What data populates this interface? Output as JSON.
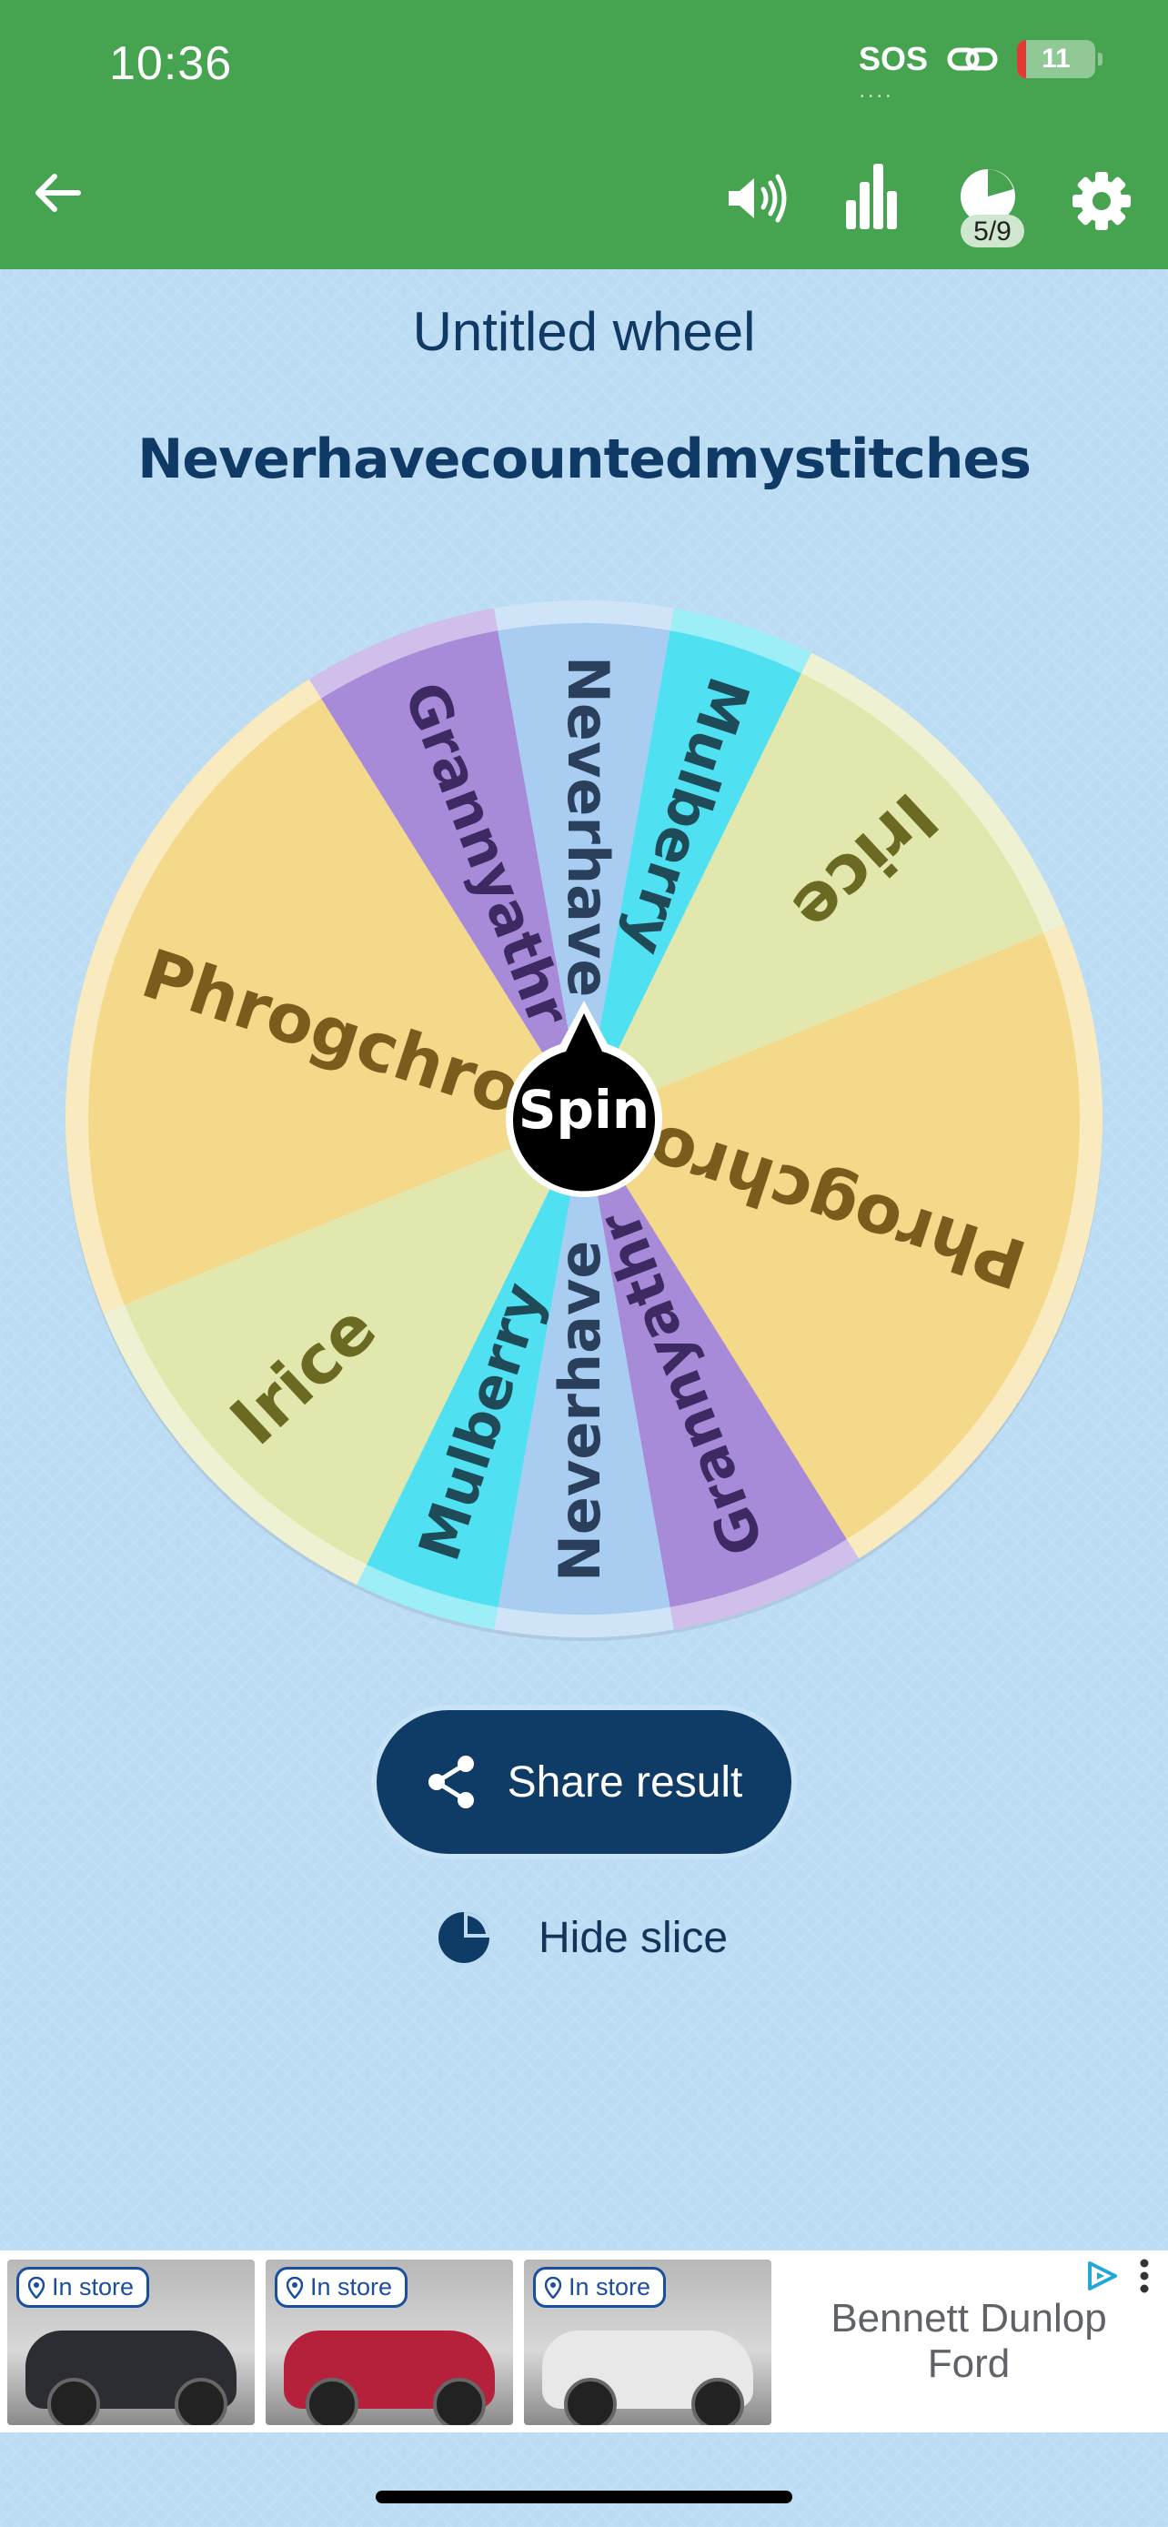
{
  "status_bar": {
    "time": "10:36",
    "sos": "SOS",
    "battery": "11"
  },
  "toolbar": {
    "progress_badge": "5/9"
  },
  "wheel": {
    "title": "Untitled wheel",
    "result": "Neverhavecountedmystitches",
    "spin_label": "Spin",
    "slices": [
      {
        "label": "Irice",
        "color": "#e2e8ad",
        "text_color": "#6b6a22"
      },
      {
        "label": "Phrogchroc",
        "color": "#f5d98a",
        "text_color": "#7a5c1c"
      },
      {
        "label": "Grannyathr",
        "color": "#a78ad8",
        "text_color": "#3e2a62"
      },
      {
        "label": "Neverhave",
        "color": "#a8cdf0",
        "text_color": "#2a3f5c"
      },
      {
        "label": "Mulberry",
        "color": "#4fe0f2",
        "text_color": "#1f4a58"
      },
      {
        "label": "Irice",
        "color": "#e2e8ad",
        "text_color": "#6b6a22"
      },
      {
        "label": "Phrogchroc",
        "color": "#f5d98a",
        "text_color": "#7a5c1c"
      },
      {
        "label": "Grannyathr",
        "color": "#a78ad8",
        "text_color": "#3e2a62"
      },
      {
        "label": "Neverhave",
        "color": "#a8cdf0",
        "text_color": "#2a3f5c"
      },
      {
        "label": "Mulberry",
        "color": "#4fe0f2",
        "text_color": "#1f4a58"
      }
    ]
  },
  "actions": {
    "share_label": "Share result",
    "hide_slice_label": "Hide slice"
  },
  "ad": {
    "badges": [
      "In store",
      "In store",
      "In store"
    ],
    "car_colors": [
      "#2b2d33",
      "#b5203a",
      "#e8e8e8"
    ],
    "advertiser": "Bennett Dunlop Ford"
  },
  "colors": {
    "app_bar": "#46a350",
    "primary": "#0f3c66",
    "background": "#bcdcf4"
  }
}
